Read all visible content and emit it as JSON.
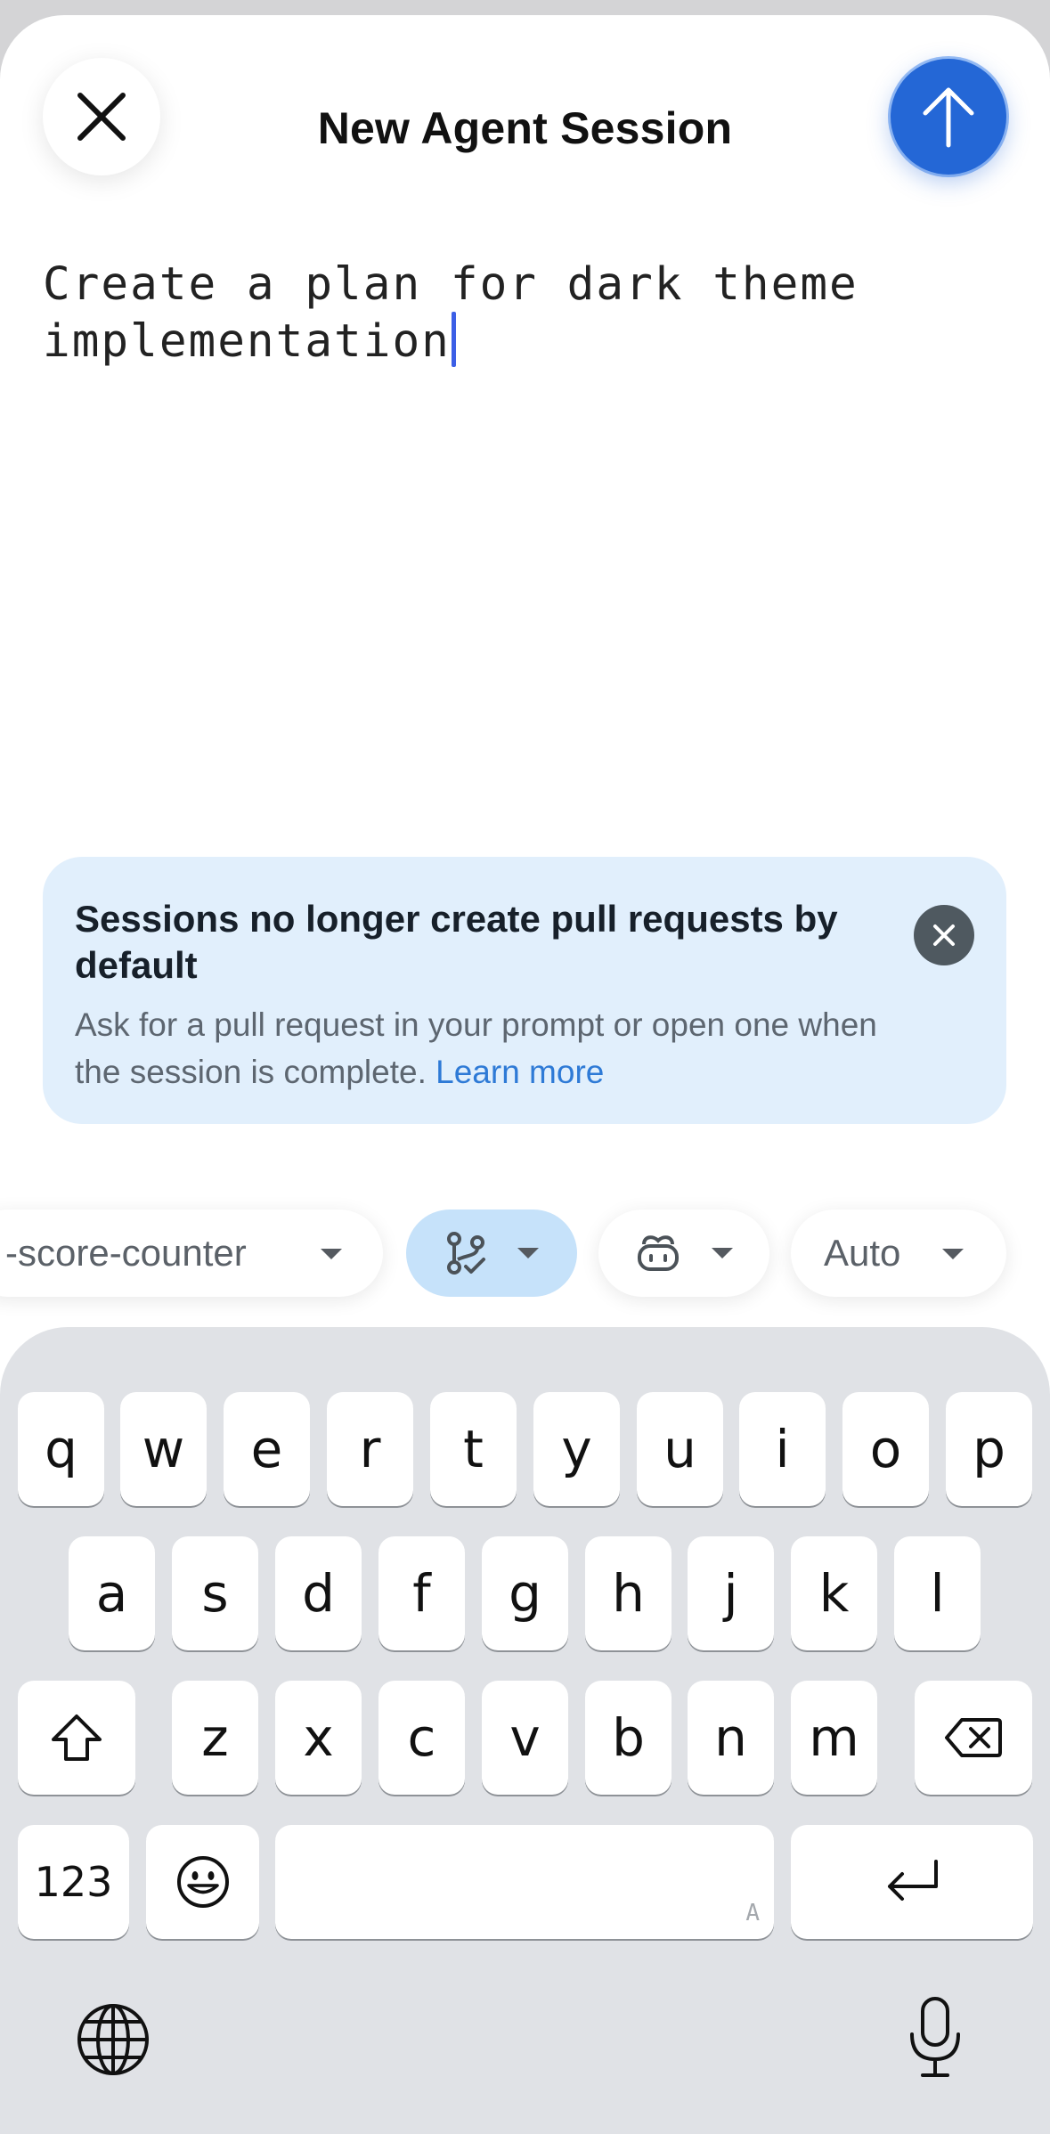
{
  "header": {
    "title": "New Agent Session",
    "close_icon": "close-icon",
    "send_icon": "arrow-up-icon"
  },
  "prompt": {
    "line1": "Create a plan for dark theme",
    "line2": "implementation"
  },
  "banner": {
    "title": "Sessions no longer create pull requests by default",
    "body": "Ask for a pull request in your prompt or open one when the session is complete.",
    "link": "Learn more",
    "close_icon": "close-icon"
  },
  "chips": {
    "repo": "-score-counter",
    "branch_icon": "branch-check-icon",
    "agent_icon": "copilot-icon",
    "model": "Auto"
  },
  "keyboard": {
    "row1": [
      "q",
      "w",
      "e",
      "r",
      "t",
      "y",
      "u",
      "i",
      "o",
      "p"
    ],
    "row2": [
      "a",
      "s",
      "d",
      "f",
      "g",
      "h",
      "j",
      "k",
      "l"
    ],
    "row3": [
      "z",
      "x",
      "c",
      "v",
      "b",
      "n",
      "m"
    ],
    "numbers_key": "123",
    "space_hint": "A",
    "shift_icon": "shift-icon",
    "delete_icon": "backspace-icon",
    "emoji_icon": "emoji-icon",
    "return_icon": "return-icon",
    "globe_icon": "globe-icon",
    "mic_icon": "microphone-icon"
  },
  "colors": {
    "accent": "#2467d6",
    "banner_bg": "#e1effc",
    "link": "#2e7ad6",
    "branch_chip_bg": "#c6e2fa",
    "caret": "#3c5fe6"
  }
}
